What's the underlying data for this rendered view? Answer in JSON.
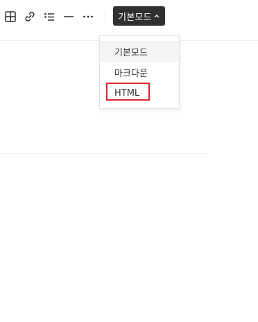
{
  "toolbar": {
    "icons": [
      "table-icon",
      "link-icon",
      "list-icon",
      "horizontal-rule-icon",
      "more-icon"
    ],
    "mode_button_label": "기본모드"
  },
  "mode_dropdown": {
    "items": [
      {
        "label": "기본모드",
        "selected": true
      },
      {
        "label": "마크다운",
        "selected": false
      },
      {
        "label": "HTML",
        "selected": false,
        "highlighted": true
      }
    ]
  },
  "colors": {
    "mode_button_bg": "#303030",
    "highlight_border": "#d9262b"
  }
}
